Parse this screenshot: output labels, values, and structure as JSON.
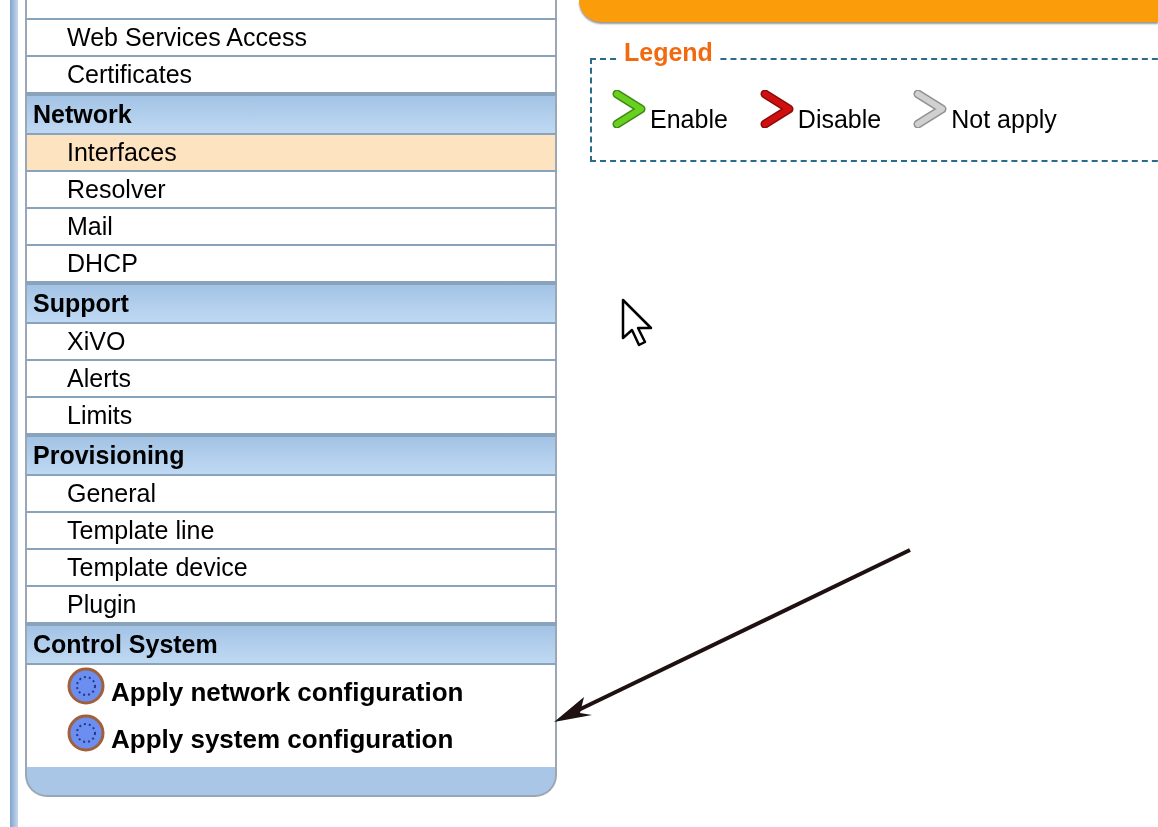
{
  "sidebar": {
    "sections": [
      {
        "items": [
          {
            "kind": "link",
            "label": "Web Services Access",
            "selected": false
          },
          {
            "kind": "link",
            "label": "Certificates",
            "selected": false
          }
        ]
      },
      {
        "title": "Network",
        "items": [
          {
            "kind": "link",
            "label": "Interfaces",
            "selected": true
          },
          {
            "kind": "link",
            "label": "Resolver",
            "selected": false
          },
          {
            "kind": "link",
            "label": "Mail",
            "selected": false
          },
          {
            "kind": "link",
            "label": "DHCP",
            "selected": false
          }
        ]
      },
      {
        "title": "Support",
        "items": [
          {
            "kind": "link",
            "label": "XiVO",
            "selected": false
          },
          {
            "kind": "link",
            "label": "Alerts",
            "selected": false
          },
          {
            "kind": "link",
            "label": "Limits",
            "selected": false
          }
        ]
      },
      {
        "title": "Provisioning",
        "items": [
          {
            "kind": "link",
            "label": "General",
            "selected": false
          },
          {
            "kind": "link",
            "label": "Template line",
            "selected": false
          },
          {
            "kind": "link",
            "label": "Template device",
            "selected": false
          },
          {
            "kind": "link",
            "label": "Plugin",
            "selected": false
          }
        ]
      },
      {
        "title": "Control System",
        "items": [
          {
            "kind": "action",
            "label": "Apply network configuration",
            "selected": false
          },
          {
            "kind": "action",
            "label": "Apply system configuration",
            "selected": false
          }
        ]
      }
    ]
  },
  "legend": {
    "title": "Legend",
    "items": [
      {
        "kind": "enable",
        "label": "Enable"
      },
      {
        "kind": "disable",
        "label": "Disable"
      },
      {
        "kind": "not_apply",
        "label": "Not apply"
      }
    ]
  }
}
